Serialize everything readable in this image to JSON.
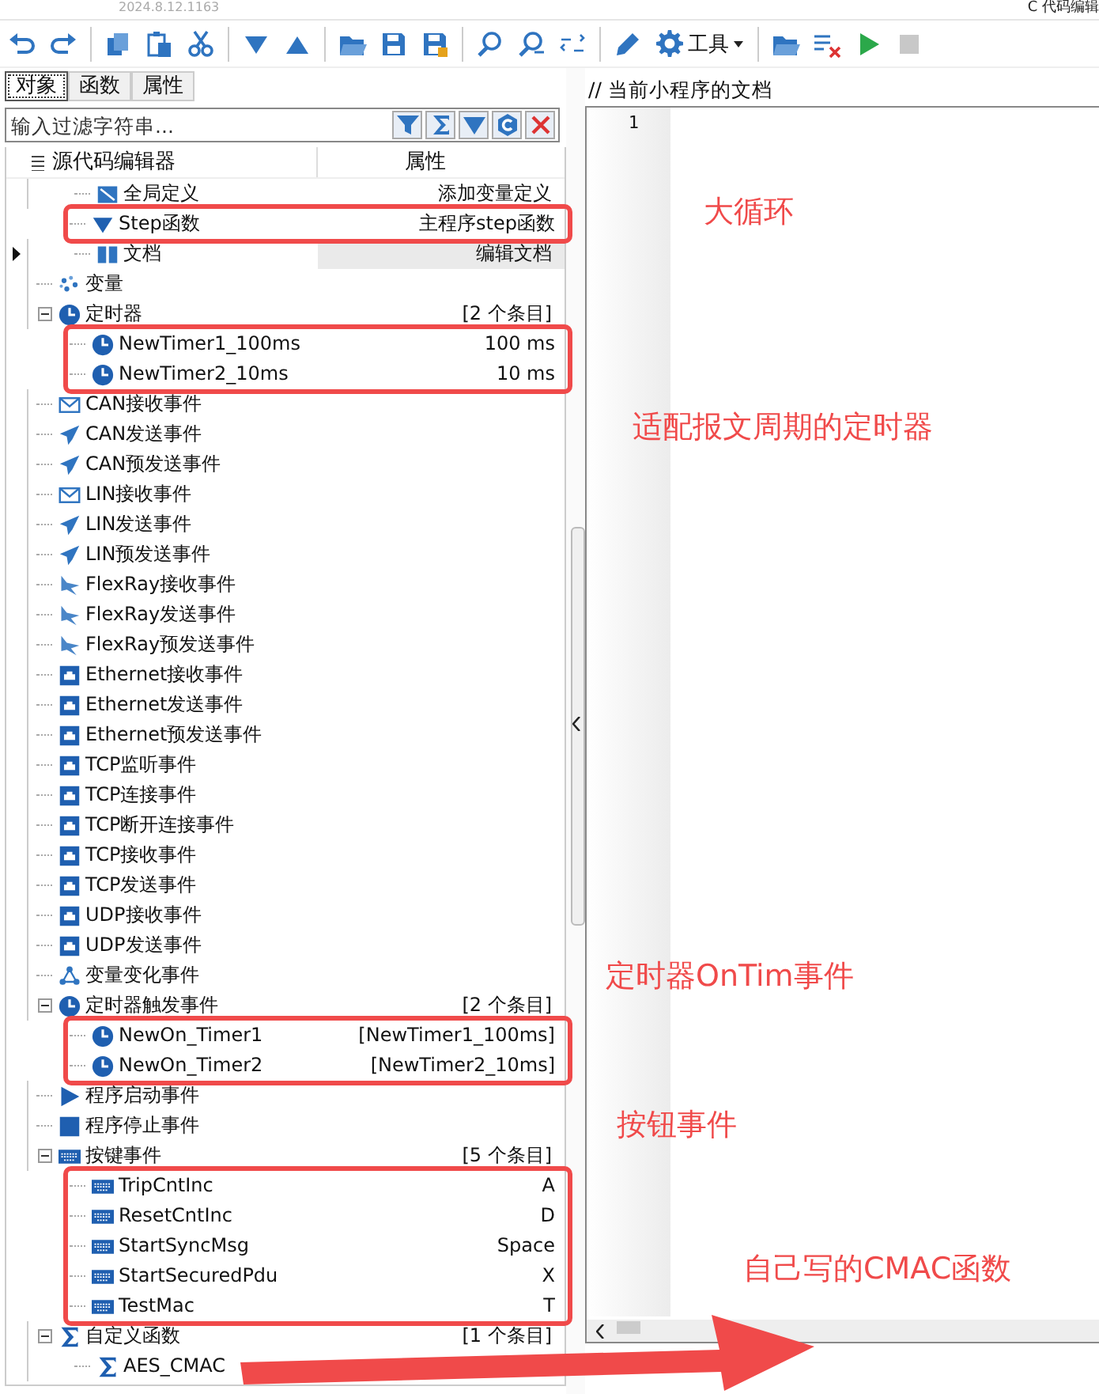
{
  "header": {
    "version": "2024.8.12.1163",
    "title": "C 代码编辑"
  },
  "toolbar": [
    {
      "kind": "undo",
      "disabled": false
    },
    {
      "kind": "redo",
      "disabled": false
    },
    {
      "kind": "sep"
    },
    {
      "kind": "copy",
      "disabled": false
    },
    {
      "kind": "paste",
      "disabled": false
    },
    {
      "kind": "cut",
      "disabled": false
    },
    {
      "kind": "sep"
    },
    {
      "kind": "down",
      "disabled": false
    },
    {
      "kind": "up",
      "disabled": false
    },
    {
      "kind": "sep"
    },
    {
      "kind": "export",
      "disabled": false
    },
    {
      "kind": "save",
      "disabled": false
    },
    {
      "kind": "saveall",
      "disabled": false
    },
    {
      "kind": "sep"
    },
    {
      "kind": "find",
      "disabled": false
    },
    {
      "kind": "findnext",
      "disabled": false
    },
    {
      "kind": "replace",
      "disabled": false
    },
    {
      "kind": "sep"
    },
    {
      "kind": "pencil",
      "disabled": false
    },
    {
      "kind": "menu",
      "label": "工具"
    },
    {
      "kind": "sep"
    },
    {
      "kind": "folder",
      "disabled": false
    },
    {
      "kind": "clear",
      "disabled": false
    },
    {
      "kind": "run",
      "disabled": false
    },
    {
      "kind": "stop",
      "disabled": true
    }
  ],
  "tabs": [
    {
      "label": "对象",
      "selected": true
    },
    {
      "label": "函数",
      "selected": false
    },
    {
      "label": "属性",
      "selected": false
    }
  ],
  "filter": {
    "placeholder": "输入过滤字符串...",
    "buttons": [
      {
        "kind": "filter"
      },
      {
        "kind": "sigma"
      },
      {
        "kind": "down"
      },
      {
        "kind": "c"
      },
      {
        "kind": "close"
      }
    ]
  },
  "tree": {
    "columns": [
      "源代码编辑器",
      "属性"
    ],
    "scrolled_parent_children": [
      {
        "kind": "global",
        "name": "全局定义",
        "value": "添加变量定义",
        "selected": false,
        "boxed": false
      },
      {
        "kind": "step",
        "name": "Step函数",
        "value": "主程序step函数",
        "selected": false,
        "boxed": true
      },
      {
        "kind": "doc",
        "name": "文档",
        "value": "编辑文档",
        "selected": true,
        "boxed": false
      }
    ],
    "items": [
      {
        "kind": "variable",
        "name": "变量",
        "selected": false,
        "boxed": false
      },
      {
        "kind": "timer",
        "name": "定时器",
        "value": "[2 个条目]",
        "selected": false,
        "boxed": false,
        "expanded": true,
        "children": [
          {
            "kind": "timer",
            "name": "NewTimer1_100ms",
            "value": "100 ms",
            "selected": false,
            "boxed": true
          },
          {
            "kind": "timer",
            "name": "NewTimer2_10ms",
            "value": "10 ms",
            "selected": false,
            "boxed": true
          }
        ]
      },
      {
        "kind": "mail",
        "name": "CAN接收事件",
        "selected": false,
        "boxed": false
      },
      {
        "kind": "send",
        "name": "CAN发送事件",
        "selected": false,
        "boxed": false
      },
      {
        "kind": "send",
        "name": "CAN预发送事件",
        "selected": false,
        "boxed": false
      },
      {
        "kind": "mail",
        "name": "LIN接收事件",
        "selected": false,
        "boxed": false
      },
      {
        "kind": "send",
        "name": "LIN发送事件",
        "selected": false,
        "boxed": false
      },
      {
        "kind": "send",
        "name": "LIN预发送事件",
        "selected": false,
        "boxed": false
      },
      {
        "kind": "flexray",
        "name": "FlexRay接收事件",
        "selected": false,
        "boxed": false
      },
      {
        "kind": "flexray",
        "name": "FlexRay发送事件",
        "selected": false,
        "boxed": false
      },
      {
        "kind": "flexray",
        "name": "FlexRay预发送事件",
        "selected": false,
        "boxed": false
      },
      {
        "kind": "ethernet",
        "name": "Ethernet接收事件",
        "selected": false,
        "boxed": false
      },
      {
        "kind": "ethernet",
        "name": "Ethernet发送事件",
        "selected": false,
        "boxed": false
      },
      {
        "kind": "ethernet",
        "name": "Ethernet预发送事件",
        "selected": false,
        "boxed": false
      },
      {
        "kind": "ethernet",
        "name": "TCP监听事件",
        "selected": false,
        "boxed": false
      },
      {
        "kind": "ethernet",
        "name": "TCP连接事件",
        "selected": false,
        "boxed": false
      },
      {
        "kind": "ethernet",
        "name": "TCP断开连接事件",
        "selected": false,
        "boxed": false
      },
      {
        "kind": "ethernet",
        "name": "TCP接收事件",
        "selected": false,
        "boxed": false
      },
      {
        "kind": "ethernet",
        "name": "TCP发送事件",
        "selected": false,
        "boxed": false
      },
      {
        "kind": "ethernet",
        "name": "UDP接收事件",
        "selected": false,
        "boxed": false
      },
      {
        "kind": "ethernet",
        "name": "UDP发送事件",
        "selected": false,
        "boxed": false
      },
      {
        "kind": "change",
        "name": "变量变化事件",
        "selected": false,
        "boxed": false
      },
      {
        "kind": "timer",
        "name": "定时器触发事件",
        "value": "[2 个条目]",
        "selected": false,
        "boxed": false,
        "expanded": true,
        "children": [
          {
            "kind": "timer",
            "name": "NewOn_Timer1",
            "value": "[NewTimer1_100ms]",
            "selected": false,
            "boxed": true
          },
          {
            "kind": "timer",
            "name": "NewOn_Timer2",
            "value": "[NewTimer2_10ms]",
            "selected": false,
            "boxed": true
          }
        ]
      },
      {
        "kind": "play",
        "name": "程序启动事件",
        "selected": false,
        "boxed": false
      },
      {
        "kind": "stop",
        "name": "程序停止事件",
        "selected": false,
        "boxed": false
      },
      {
        "kind": "keyboard",
        "name": "按键事件",
        "value": "[5 个条目]",
        "selected": false,
        "boxed": false,
        "expanded": true,
        "children": [
          {
            "kind": "keyboard",
            "name": "TripCntInc",
            "value": "A",
            "selected": false,
            "boxed": true
          },
          {
            "kind": "keyboard",
            "name": "ResetCntInc",
            "value": "D",
            "selected": false,
            "boxed": true
          },
          {
            "kind": "keyboard",
            "name": "StartSyncMsg",
            "value": "Space",
            "selected": false,
            "boxed": true
          },
          {
            "kind": "keyboard",
            "name": "StartSecuredPdu",
            "value": "X",
            "selected": false,
            "boxed": true
          },
          {
            "kind": "keyboard",
            "name": "TestMac",
            "value": "T",
            "selected": false,
            "boxed": true
          }
        ]
      },
      {
        "kind": "sigma",
        "name": "自定义函数",
        "value": "[1 个条目]",
        "selected": false,
        "boxed": false,
        "expanded": true,
        "children": [
          {
            "kind": "sigma",
            "name": "AES_CMAC",
            "selected": false,
            "boxed": false
          }
        ]
      }
    ]
  },
  "editor": {
    "comment": "//  当前小程序的文档",
    "line_numbers": [
      "1"
    ]
  },
  "annotations": {
    "callouts": [
      "大循环",
      "适配报文周期的定时器",
      "定时器OnTim事件",
      "按钮事件",
      "自己写的CMAC函数"
    ],
    "arrow": true
  }
}
